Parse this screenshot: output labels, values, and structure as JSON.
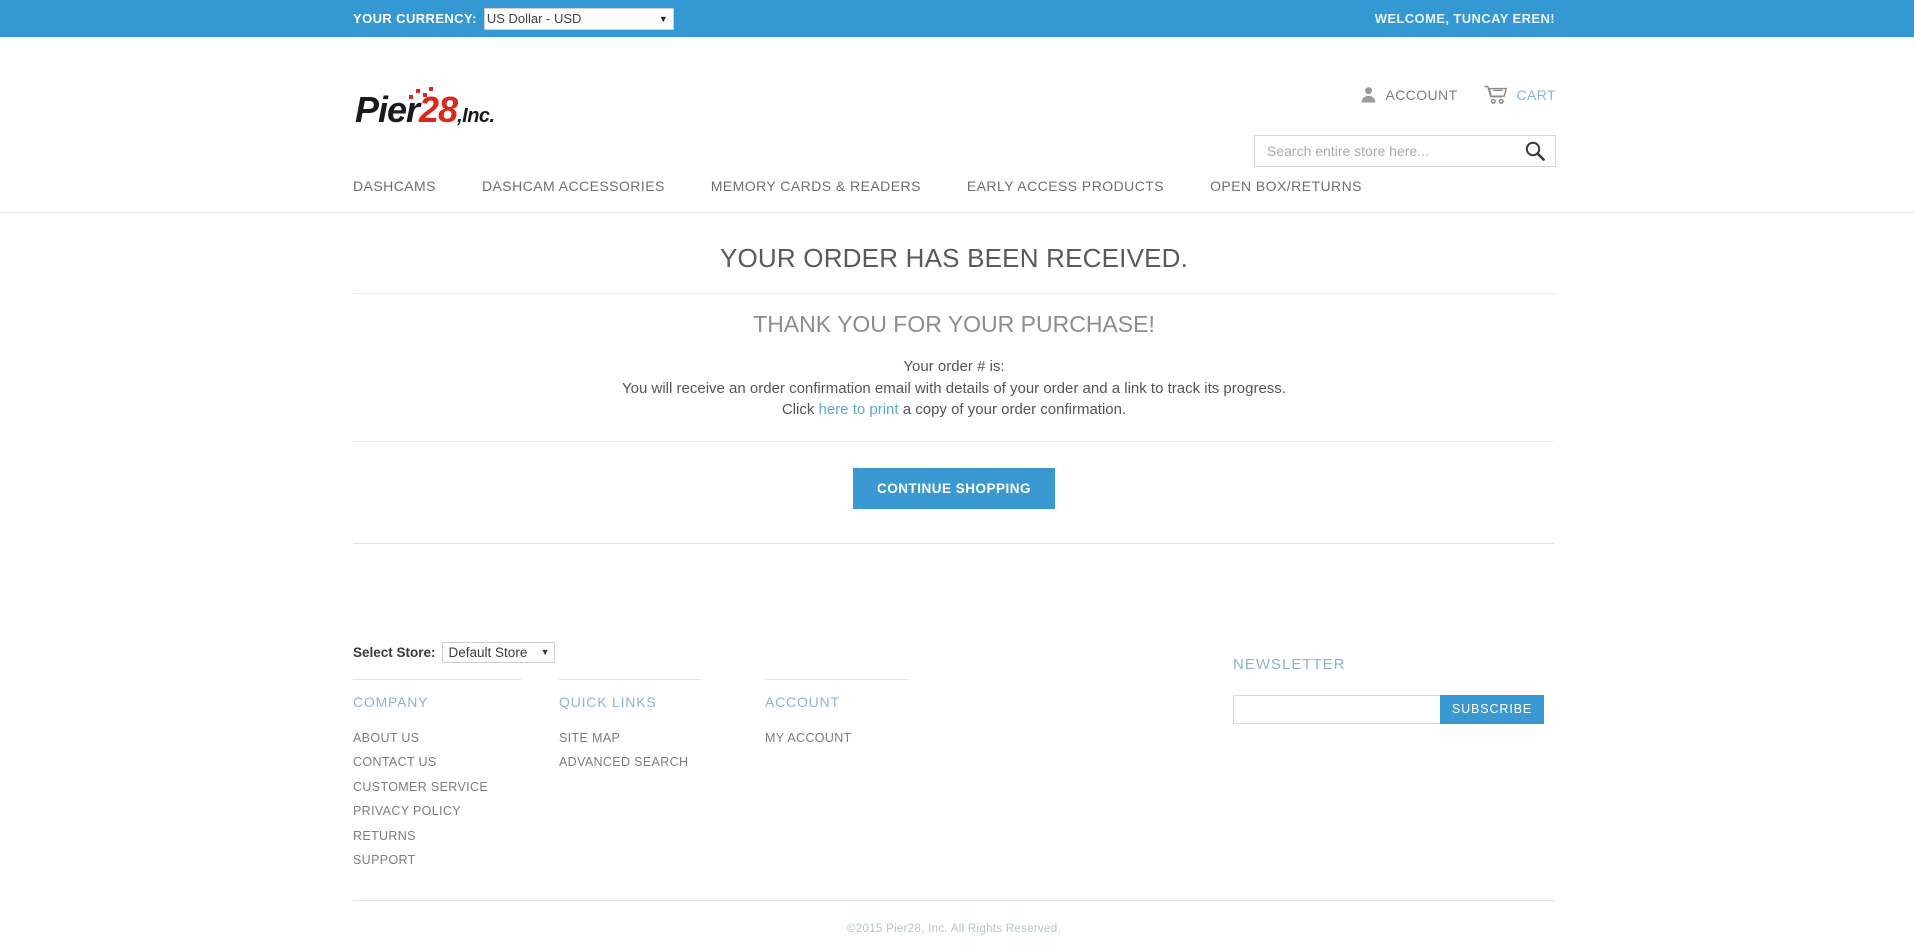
{
  "topbar": {
    "currency_label": "YOUR CURRENCY:",
    "currency_selected": "US Dollar - USD",
    "currency_arrow": "▼",
    "welcome": "WELCOME, TUNCAY EREN!"
  },
  "header": {
    "logo_part1": "Pier",
    "logo_part2": "28",
    "logo_part3": ",Inc.",
    "account_label": "ACCOUNT",
    "cart_label": "CART",
    "search_placeholder": "Search entire store here...",
    "search_value": ""
  },
  "nav": {
    "items": [
      {
        "label": "DASHCAMS"
      },
      {
        "label": "DASHCAM ACCESSORIES"
      },
      {
        "label": "MEMORY CARDS & READERS"
      },
      {
        "label": "EARLY ACCESS PRODUCTS"
      },
      {
        "label": "OPEN BOX/RETURNS"
      }
    ]
  },
  "main": {
    "heading": "YOUR ORDER HAS BEEN RECEIVED.",
    "subheading": "THANK YOU FOR YOUR PURCHASE!",
    "order_line_prefix": "Your order # is:",
    "order_number": "",
    "confirmation_line": "You will receive an order confirmation email with details of your order and a link to track its progress.",
    "print_prefix": "Click ",
    "print_link": "here to print",
    "print_suffix": " a copy of your order confirmation.",
    "continue_button": "CONTINUE SHOPPING"
  },
  "newsletter": {
    "title": "NEWSLETTER",
    "input_value": "",
    "input_placeholder": "",
    "subscribe_label": "SUBSCRIBE"
  },
  "footer": {
    "store_label": "Select Store:",
    "store_selected": "Default Store",
    "store_arrow": "▼",
    "columns": [
      {
        "heading": "COMPANY",
        "links": [
          {
            "label": "ABOUT US"
          },
          {
            "label": "CONTACT US"
          },
          {
            "label": "CUSTOMER SERVICE"
          },
          {
            "label": "PRIVACY POLICY"
          },
          {
            "label": "RETURNS"
          },
          {
            "label": "SUPPORT"
          }
        ]
      },
      {
        "heading": "QUICK LINKS",
        "links": [
          {
            "label": "SITE MAP"
          },
          {
            "label": "ADVANCED SEARCH"
          }
        ]
      },
      {
        "heading": "ACCOUNT",
        "links": [
          {
            "label": "MY ACCOUNT"
          }
        ]
      }
    ],
    "copyright": "©2015 Pier28, Inc. All Rights Reserved."
  },
  "colors": {
    "brand_blue": "#3498d2",
    "button_blue": "#3b99d2",
    "link_blue": "#5fa8d3",
    "logo_red": "#d9281c",
    "heading_blue_gray": "#8fb4cc"
  }
}
